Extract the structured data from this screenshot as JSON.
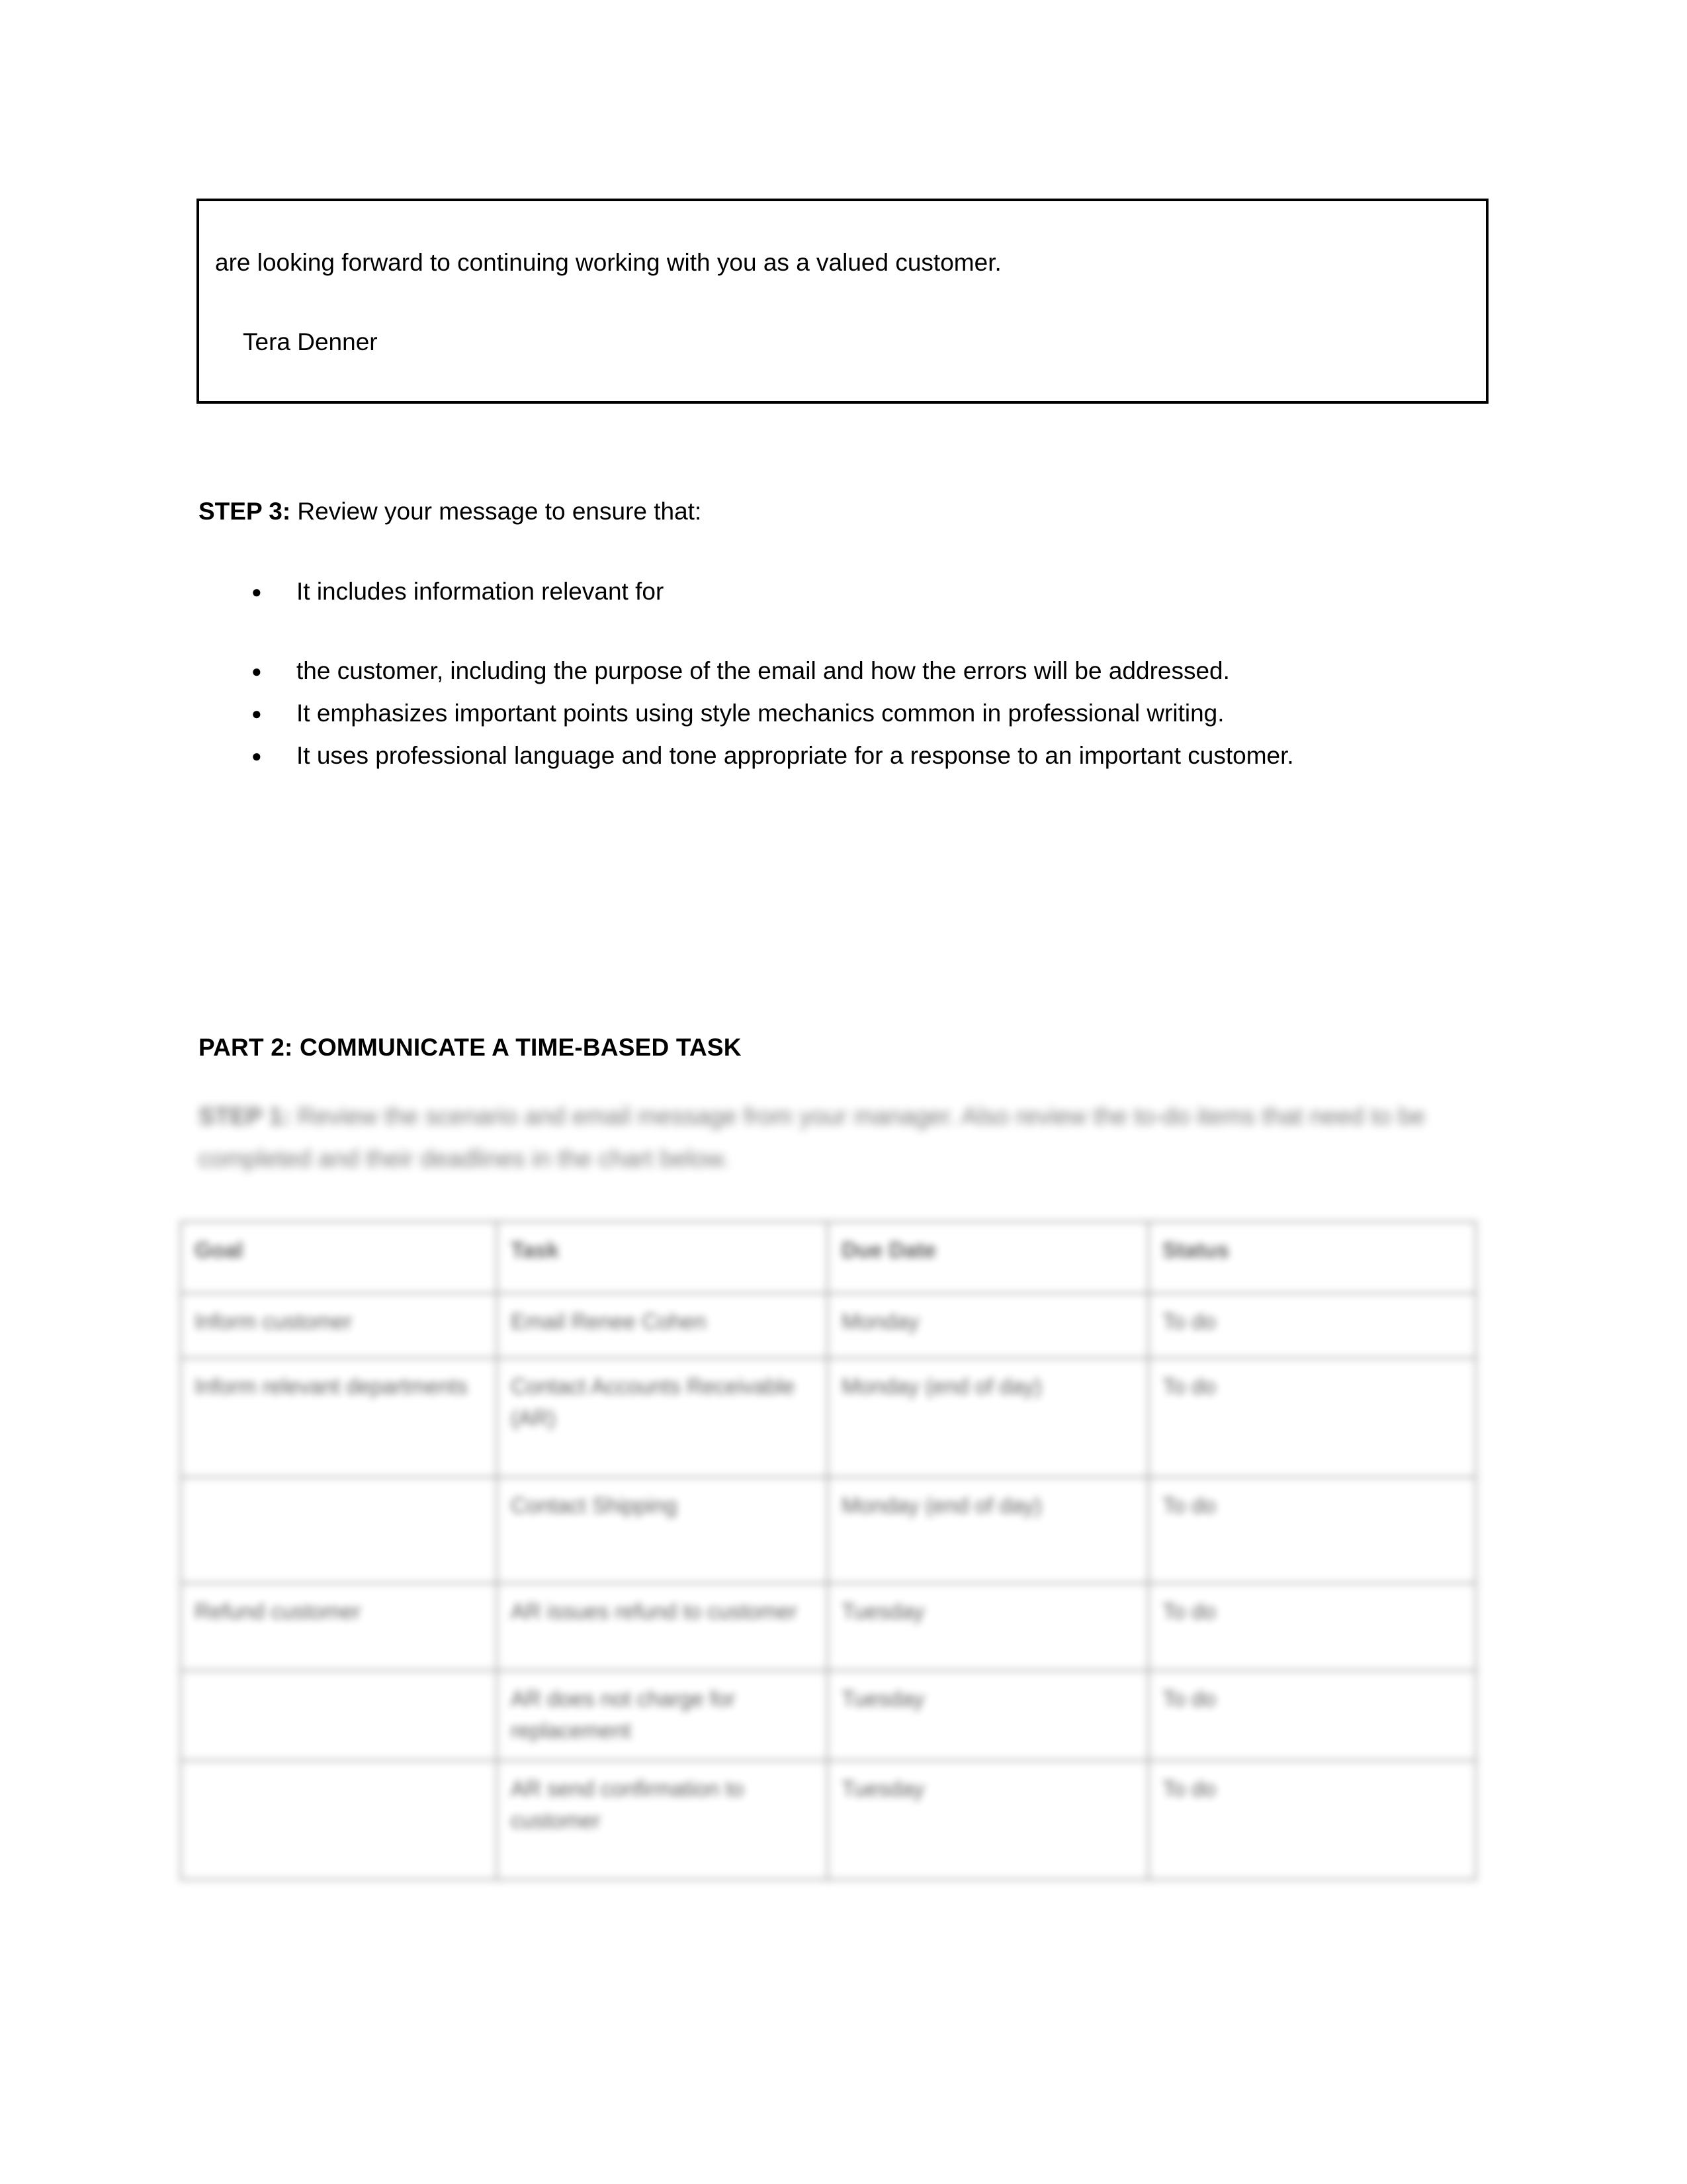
{
  "email_box": {
    "closing_line": "are looking forward to continuing working with you as a valued customer.",
    "signature": "Tera Denner"
  },
  "step3": {
    "label": "STEP 3:",
    "intro": " Review your message to ensure that:",
    "bullets": [
      "It includes information relevant for",
      " the customer, including the purpose of the email and how the errors will be addressed.",
      "It emphasizes important points using style mechanics common in professional writing.",
      "It uses professional language and tone appropriate for a response to an important customer."
    ]
  },
  "part2": {
    "heading": "PART 2: COMMUNICATE A TIME-BASED TASK",
    "intro_step_label": "STEP 1:",
    "intro_text": " Review the scenario and email message from your manager. Also review the to-do items that need to be completed and their deadlines in the chart below."
  },
  "task_table": {
    "headers": [
      "Goal",
      "Task",
      "Due Date",
      "Status"
    ],
    "rows": [
      {
        "goal": "Inform customer",
        "task": "Email Renee Cohen",
        "due": "Monday",
        "status": "To do"
      },
      {
        "goal": "Inform relevant departments",
        "task": "Contact Accounts Receivable (AR)",
        "due": "Monday (end of day)",
        "status": "To do"
      },
      {
        "goal": "",
        "task": "Contact Shipping",
        "due": "Monday (end of day)",
        "status": "To do"
      },
      {
        "goal": "Refund customer",
        "task": "AR issues refund to customer",
        "due": "Tuesday",
        "status": "To do"
      },
      {
        "goal": "",
        "task": "AR does not charge for replacement",
        "due": "Tuesday",
        "status": "To do"
      },
      {
        "goal": "",
        "task": "AR send confirmation to customer",
        "due": "Tuesday",
        "status": "To do"
      }
    ]
  }
}
